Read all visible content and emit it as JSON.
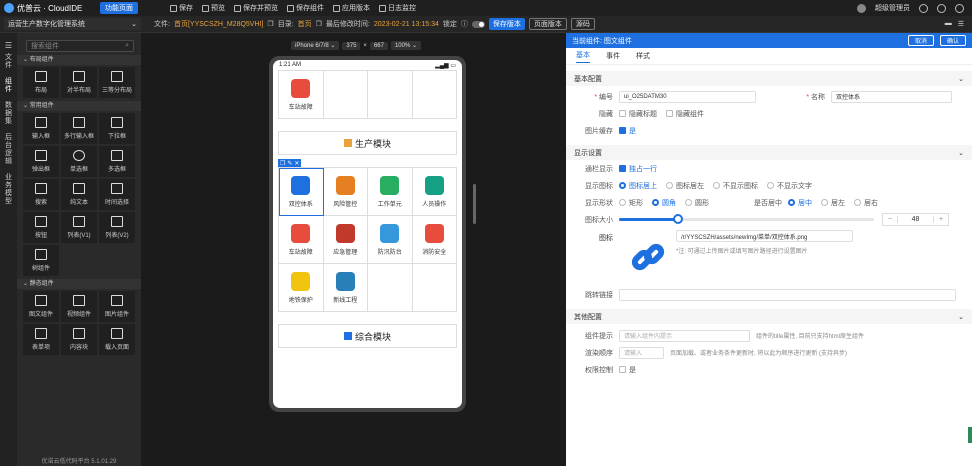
{
  "topbar": {
    "logo": "优普云 · CloudIDE",
    "home_button": "功能页面",
    "items": [
      "保存",
      "预览",
      "保存并预览",
      "保存组件",
      "应用版本",
      "日志监控"
    ],
    "user": "超级管理员"
  },
  "secbar": {
    "system": "运营生产数字化管理系统",
    "file_label": "文件:",
    "file_value": "首页[YYSCSZH_M28Q5VHI]",
    "dir_label": "目录:",
    "dir_value": "首页",
    "modified_label": "最后修改时间:",
    "modified_value": "2023-02-21 13:15:34",
    "lock_label": "锁定",
    "save_version": "保存版本",
    "page_version": "页面版本",
    "source": "源码"
  },
  "lefticons": [
    {
      "label": "文件",
      "active": false
    },
    {
      "label": "组件",
      "active": true
    },
    {
      "label": "数据集",
      "active": false
    },
    {
      "label": "后台逻辑",
      "active": false
    },
    {
      "label": "业务模型",
      "active": false
    }
  ],
  "palette": {
    "search_placeholder": "搜索组件",
    "categories": [
      {
        "name": "布局组件",
        "items": [
          "布局",
          "对半布局",
          "三等分布局"
        ]
      },
      {
        "name": "常用组件",
        "items": [
          "输入框",
          "多行输入框",
          "下拉框",
          "弹出框",
          "单选框",
          "多选框",
          "搜索",
          "纯文本",
          "时间选择",
          "按钮",
          "列表(V1)",
          "列表(V2)",
          "树组件"
        ]
      },
      {
        "name": "静态组件",
        "items": [
          "图文组件",
          "视频组件",
          "图片组件",
          "表单项",
          "内容块",
          "载入页面",
          "",
          "",
          ""
        ]
      }
    ],
    "footer": "优诺云低代码平台 5.1.01.29"
  },
  "device": {
    "model": "iPhone 6/7/8",
    "width": "375",
    "x": "×",
    "height": "667",
    "zoom": "100%"
  },
  "phone": {
    "time": "1:21 AM",
    "row0": [
      "车站故障",
      "",
      "",
      ""
    ],
    "btn1": "生产模块",
    "row1": [
      "双控体系",
      "风险管控",
      "工作单元",
      "人员操作"
    ],
    "row2": [
      "车站故障",
      "应急管理",
      "防汛防台",
      "消防安全"
    ],
    "row3": [
      "地铁保护",
      "新线工程",
      "",
      ""
    ],
    "btn2": "综合模块"
  },
  "panel": {
    "title": "当前组件: 图文组件",
    "cancel": "取消",
    "confirm": "确认",
    "tabs": [
      "基本",
      "事件",
      "样式"
    ],
    "basic": {
      "header": "基本配置",
      "id_label": "编号",
      "id_value": "ui_O25DATM30",
      "name_label": "名称",
      "name_value": "双控体系",
      "hide_label": "隐藏",
      "hide_title": "隐藏标题",
      "hide_comp": "隐藏组件",
      "cache_label": "图片缓存",
      "cache_value": "是"
    },
    "display": {
      "header": "显示设置",
      "scroll_label": "通栏显示",
      "scroll_value": "独占一行",
      "icon_label": "显示图标",
      "icon_options": [
        "图标居上",
        "图标居左",
        "不显示图标",
        "不显示文字"
      ],
      "shape_label": "显示形状",
      "shape_options": [
        "矩形",
        "圆角",
        "圆形"
      ],
      "center_label": "是否居中",
      "center_options": [
        "居中",
        "居左",
        "居右"
      ],
      "size_label": "图标大小",
      "size_value": "48",
      "size_fraction": 0.23,
      "icon_path_label": "图标",
      "icon_path": "/r/YYSCSZH/assets/newImg/菜单/双控体系.png",
      "icon_note": "*注: 可通过上传图片或填写图片路径进行设置图片",
      "jump_label": "跳转链接"
    },
    "other": {
      "header": "其他配置",
      "tip_label": "组件提示",
      "tip_placeholder": "请输入组件内提示",
      "tip_note": "组件的title属性, 目前只支持html原生组件",
      "order_label": "渲染顺序",
      "order_placeholder": "请输入",
      "order_note": "页面加载、或者业务条件更新时, 将以此为顺序进行更新 (支持异步)",
      "perm_label": "权限控制",
      "perm_value": "是"
    }
  },
  "colors": {
    "accent": "#1e6fe0",
    "warn": "#e8a33c"
  }
}
